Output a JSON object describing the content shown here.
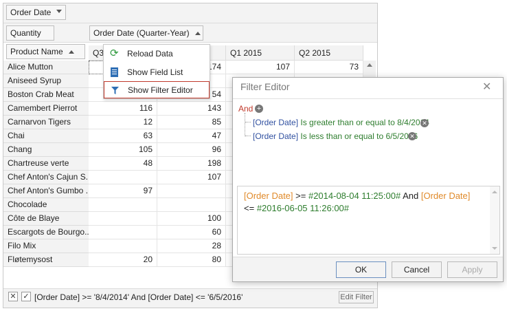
{
  "filter_area": {
    "field": "Order Date"
  },
  "data_area": {
    "field": "Quantity"
  },
  "column_area": {
    "field": "Order Date (Quarter-Year)"
  },
  "row_area": {
    "field": "Product Name"
  },
  "columns": [
    "Q3",
    "",
    "Q1 2015",
    "Q2 2015"
  ],
  "rows": [
    {
      "name": "Alice Mutton",
      "c1": "",
      "c2": "174",
      "c3": "107",
      "c4": "73"
    },
    {
      "name": "Aniseed Syrup",
      "c1": "",
      "c2": "",
      "c3": "",
      "c4": ""
    },
    {
      "name": "Boston Crab Meat",
      "c1": "",
      "c2": "54",
      "c3": "",
      "c4": ""
    },
    {
      "name": "Camembert Pierrot",
      "c1": "116",
      "c2": "143",
      "c3": "",
      "c4": ""
    },
    {
      "name": "Carnarvon Tigers",
      "c1": "12",
      "c2": "85",
      "c3": "",
      "c4": ""
    },
    {
      "name": "Chai",
      "c1": "63",
      "c2": "47",
      "c3": "",
      "c4": ""
    },
    {
      "name": "Chang",
      "c1": "105",
      "c2": "96",
      "c3": "",
      "c4": ""
    },
    {
      "name": "Chartreuse verte",
      "c1": "48",
      "c2": "198",
      "c3": "",
      "c4": ""
    },
    {
      "name": "Chef Anton's Cajun S...",
      "c1": "",
      "c2": "107",
      "c3": "",
      "c4": ""
    },
    {
      "name": "Chef Anton's Gumbo ...",
      "c1": "97",
      "c2": "",
      "c3": "",
      "c4": ""
    },
    {
      "name": "Chocolade",
      "c1": "",
      "c2": "",
      "c3": "",
      "c4": ""
    },
    {
      "name": "Côte de Blaye",
      "c1": "",
      "c2": "100",
      "c3": "",
      "c4": ""
    },
    {
      "name": "Escargots de Bourgo...",
      "c1": "",
      "c2": "60",
      "c3": "",
      "c4": ""
    },
    {
      "name": "Filo Mix",
      "c1": "",
      "c2": "28",
      "c3": "",
      "c4": ""
    },
    {
      "name": "Fløtemysost",
      "c1": "20",
      "c2": "80",
      "c3": "",
      "c4": ""
    }
  ],
  "context_menu": {
    "items": [
      {
        "label": "Reload Data",
        "icon": "refresh-icon"
      },
      {
        "label": "Show Field List",
        "icon": "field-list-icon"
      },
      {
        "label": "Show Filter Editor",
        "icon": "filter-icon"
      }
    ]
  },
  "filter_editor": {
    "title": "Filter Editor",
    "group_op": "And",
    "conditions": [
      {
        "field": "[Order Date]",
        "op": "Is greater than or equal to",
        "value": "8/4/2014"
      },
      {
        "field": "[Order Date]",
        "op": "Is less than or equal to",
        "value": "6/5/2016"
      }
    ],
    "expression": {
      "f1": "[Order Date]",
      "o1": ">=",
      "v1": "#2014-08-04 11:25:00#",
      "and": "And",
      "f2": "[Order Date]",
      "o2": "<=",
      "v2": "#2016-06-05 11:26:00#"
    },
    "ok": "OK",
    "cancel": "Cancel",
    "apply": "Apply"
  },
  "status_bar": {
    "filter_text": "[Order Date] >= '8/4/2014' And [Order Date] <= '6/5/2016'",
    "edit_filter": "Edit Filter"
  },
  "colors": {
    "accent": "#c0392b",
    "field": "#3050a0",
    "value": "#2e7d2e",
    "expr_field": "#e08a2a"
  }
}
